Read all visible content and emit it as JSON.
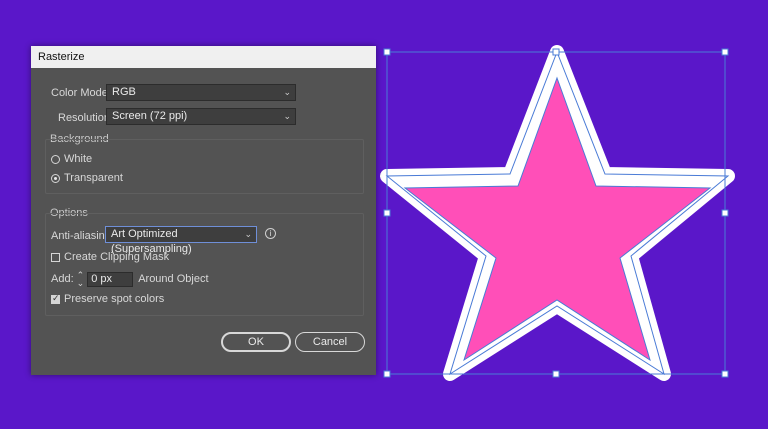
{
  "dialog": {
    "title": "Rasterize",
    "color_model": {
      "label": "Color Model:",
      "value": "RGB"
    },
    "resolution": {
      "label": "Resolution:",
      "value": "Screen (72 ppi)"
    },
    "background": {
      "title": "Background",
      "options": [
        {
          "label": "White",
          "selected": false
        },
        {
          "label": "Transparent",
          "selected": true
        }
      ]
    },
    "options": {
      "title": "Options",
      "anti_aliasing": {
        "label": "Anti-aliasing:",
        "value": "Art Optimized (Supersampling)"
      },
      "create_clipping_mask": {
        "label": "Create Clipping Mask",
        "checked": false
      },
      "add": {
        "label": "Add:",
        "value": "0 px",
        "suffix": "Around Object"
      },
      "preserve_spot_colors": {
        "label": "Preserve spot colors",
        "checked": true
      }
    },
    "ok_label": "OK",
    "cancel_label": "Cancel"
  },
  "icons": {
    "chevron": "chevron-down-icon",
    "info": "info-icon",
    "stepper": "stepper-icon"
  },
  "artwork": {
    "fill_color": "#ff4fb8",
    "stroke_color": "#ffffff",
    "selection_color": "#4a7bd6",
    "background_color": "#5a17c9"
  }
}
